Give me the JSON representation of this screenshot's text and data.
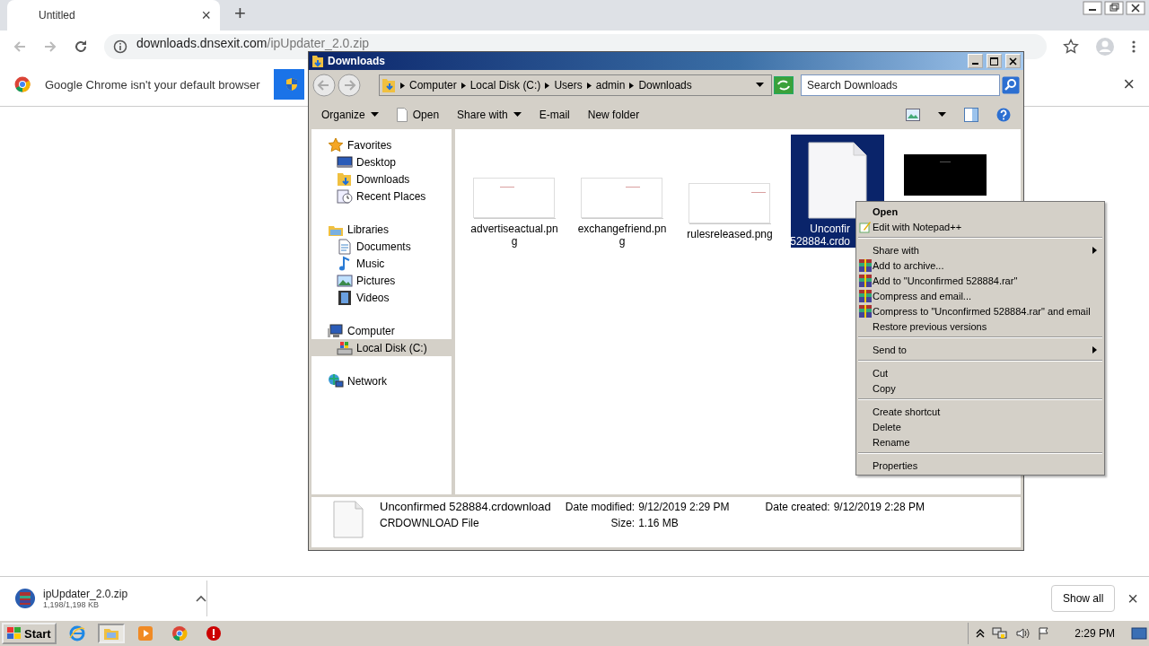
{
  "browser": {
    "tab": {
      "title": "Untitled",
      "close": "×"
    },
    "new_tab": "+",
    "url": {
      "host": "downloads.dnsexit.com",
      "path": "/ipUpdater_2.0.zip"
    },
    "infobar": {
      "message": "Google Chrome isn't your default browser",
      "close": "×"
    }
  },
  "explorer": {
    "title": "Downloads",
    "breadcrumb": [
      "Computer",
      "Local Disk (C:)",
      "Users",
      "admin",
      "Downloads"
    ],
    "search": {
      "placeholder": "Search Downloads"
    },
    "toolbar": [
      {
        "label": "Organize",
        "kind": "menu"
      },
      {
        "label": "Open",
        "kind": "file"
      },
      {
        "label": "Share with",
        "kind": "menu"
      },
      {
        "label": "E-mail",
        "kind": "plain"
      },
      {
        "label": "New folder",
        "kind": "plain"
      }
    ],
    "nav": [
      {
        "label": "Favorites",
        "selected": false,
        "children": [
          {
            "label": "Desktop",
            "selected": false
          },
          {
            "label": "Downloads",
            "selected": false
          },
          {
            "label": "Recent Places",
            "selected": false
          }
        ]
      },
      {
        "label": "Libraries",
        "selected": false,
        "children": [
          {
            "label": "Documents",
            "selected": false
          },
          {
            "label": "Music",
            "selected": false
          },
          {
            "label": "Pictures",
            "selected": false
          },
          {
            "label": "Videos",
            "selected": false
          }
        ]
      },
      {
        "label": "Computer",
        "selected": false,
        "children": [
          {
            "label": "Local Disk (C:)",
            "selected": true
          }
        ]
      },
      {
        "label": "Network",
        "selected": false
      }
    ],
    "files": [
      {
        "kind": "thumb",
        "lines": [
          "advertiseactual.pn",
          "g"
        ],
        "selected": false
      },
      {
        "kind": "thumb",
        "lines": [
          "exchangefriend.pn",
          "g"
        ],
        "selected": false
      },
      {
        "kind": "thumb",
        "lines": [
          "rulesreleased.png"
        ],
        "selected": false
      },
      {
        "kind": "document",
        "lines": [
          "Unconfir",
          "528884.crdo"
        ],
        "selected": true
      },
      {
        "kind": "dark",
        "selected": false
      }
    ],
    "details": {
      "name": "Unconfirmed 528884.crdownload",
      "type": "CRDOWNLOAD File",
      "modified_label": "Date modified:",
      "modified": "9/12/2019 2:29 PM",
      "created_label": "Date created:",
      "created": "9/12/2019 2:28 PM",
      "size_label": "Size:",
      "size": "1.16 MB"
    }
  },
  "context_menu": [
    {
      "kind": "bold",
      "label": "Open"
    },
    {
      "kind": "notepad",
      "label": "Edit with Notepad++"
    },
    {
      "kind": "separator"
    },
    {
      "kind": "submenu",
      "label": "Share with"
    },
    {
      "kind": "archive",
      "label": "Add to archive..."
    },
    {
      "kind": "archive",
      "label": "Add to \"Unconfirmed 528884.rar\""
    },
    {
      "kind": "archive",
      "label": "Compress and email..."
    },
    {
      "kind": "archive",
      "label": "Compress to \"Unconfirmed 528884.rar\" and email"
    },
    {
      "kind": "plain",
      "label": "Restore previous versions"
    },
    {
      "kind": "separator"
    },
    {
      "kind": "submenu",
      "label": "Send to"
    },
    {
      "kind": "separator"
    },
    {
      "kind": "plain",
      "label": "Cut"
    },
    {
      "kind": "plain",
      "label": "Copy"
    },
    {
      "kind": "separator"
    },
    {
      "kind": "plain",
      "label": "Create shortcut"
    },
    {
      "kind": "plain",
      "label": "Delete"
    },
    {
      "kind": "plain",
      "label": "Rename"
    },
    {
      "kind": "separator"
    },
    {
      "kind": "plain",
      "label": "Properties"
    }
  ],
  "download_bar": {
    "file": "ipUpdater_2.0.zip",
    "progress": "1,198/1,198 KB",
    "show_all": "Show all",
    "close": "×"
  },
  "taskbar": {
    "start": "Start",
    "apps": [
      {
        "selected": false
      },
      {
        "selected": true
      },
      {
        "selected": false
      },
      {
        "selected": false
      },
      {
        "selected": false
      }
    ],
    "clock": "2:29 PM"
  }
}
